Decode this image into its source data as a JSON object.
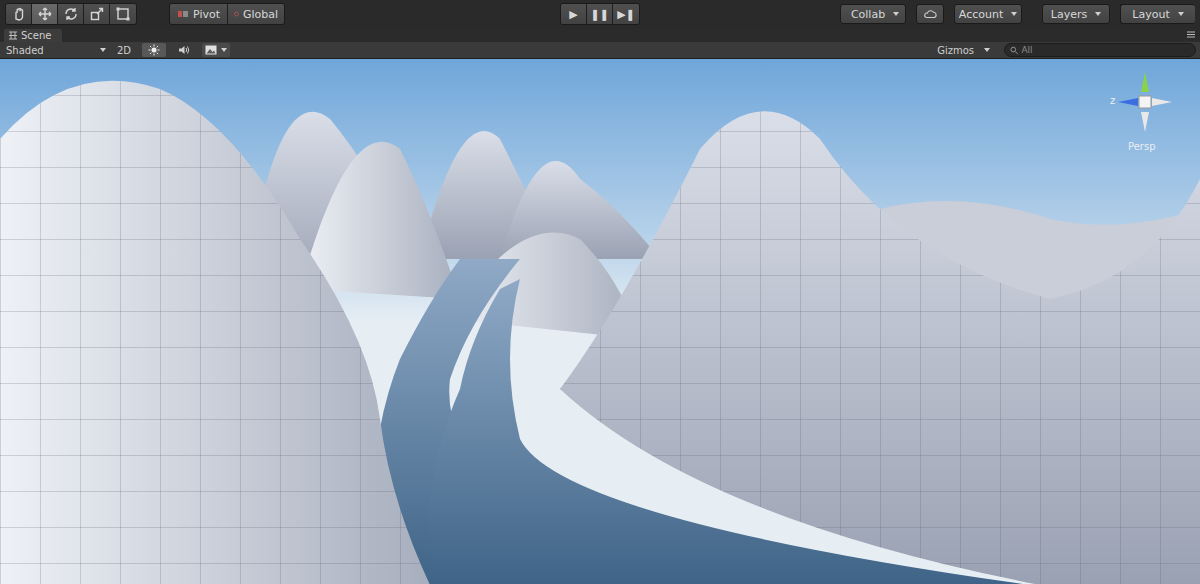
{
  "toolbar": {
    "tools": [
      {
        "selected": false
      },
      {
        "selected": true
      },
      {
        "selected": false
      },
      {
        "selected": false
      },
      {
        "selected": false
      }
    ],
    "pivot": "Pivot",
    "global": "Global",
    "play": [
      {
        "label": "▶",
        "selected": false
      },
      {
        "label": "❚❚",
        "selected": false
      },
      {
        "label": "▶❚",
        "selected": false
      }
    ],
    "collab": "Collab",
    "account": "Account",
    "layers": "Layers",
    "layout": "Layout"
  },
  "scene_tab": {
    "title": "Scene"
  },
  "scene_toolbar": {
    "shading": "Shaded",
    "mode_2d": {
      "label": "2D",
      "selected": false
    },
    "lighting": {
      "selected": true
    },
    "audio": {
      "selected": false
    },
    "effects": {
      "selected": false
    },
    "gizmos": "Gizmos",
    "search": {
      "placeholder": "All"
    }
  },
  "gizmo": {
    "axis": "z",
    "projection": "Persp"
  }
}
